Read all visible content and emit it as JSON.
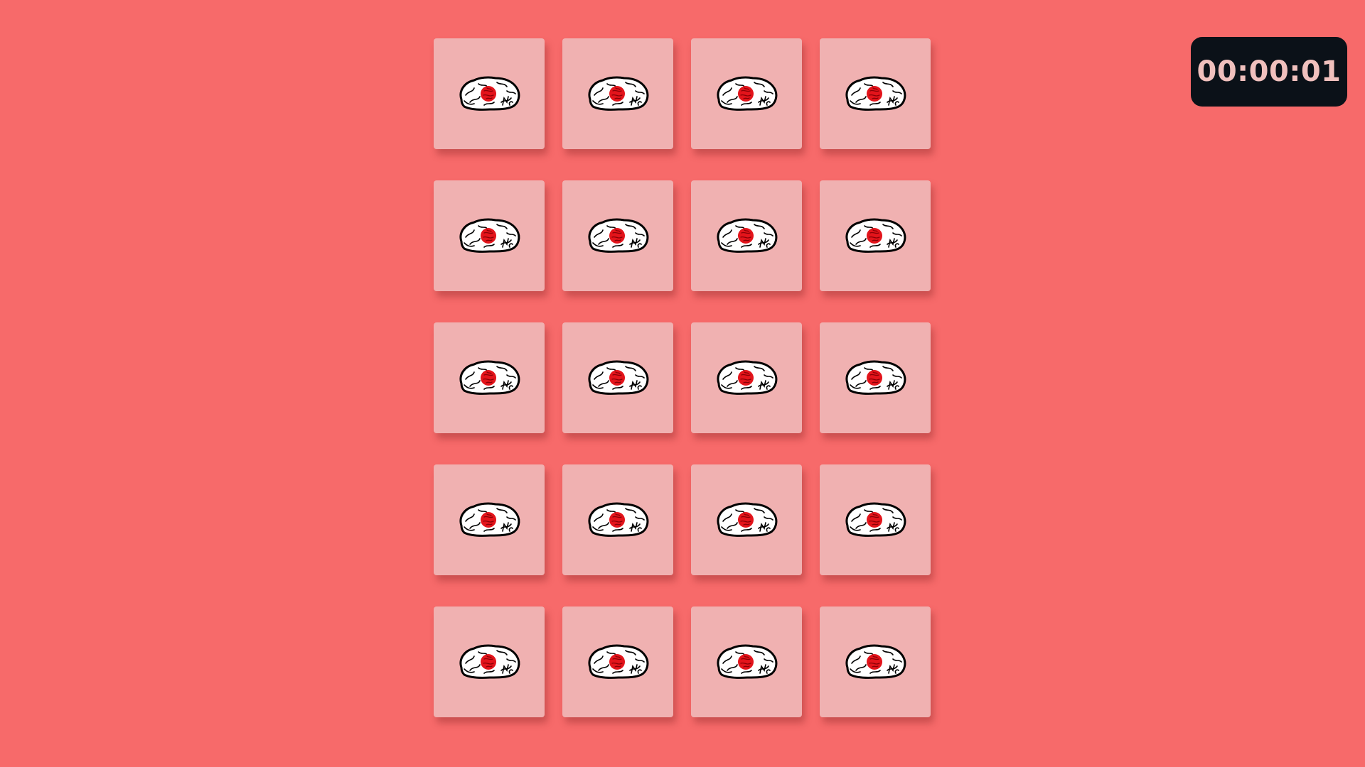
{
  "timer": {
    "value": "00:00:01"
  },
  "board": {
    "rows": 5,
    "columns": 4,
    "cards": [
      {
        "icon": "brain-icon",
        "face": "down"
      },
      {
        "icon": "brain-icon",
        "face": "down"
      },
      {
        "icon": "brain-icon",
        "face": "down"
      },
      {
        "icon": "brain-icon",
        "face": "down"
      },
      {
        "icon": "brain-icon",
        "face": "down"
      },
      {
        "icon": "brain-icon",
        "face": "down"
      },
      {
        "icon": "brain-icon",
        "face": "down"
      },
      {
        "icon": "brain-icon",
        "face": "down"
      },
      {
        "icon": "brain-icon",
        "face": "down"
      },
      {
        "icon": "brain-icon",
        "face": "down"
      },
      {
        "icon": "brain-icon",
        "face": "down"
      },
      {
        "icon": "brain-icon",
        "face": "down"
      },
      {
        "icon": "brain-icon",
        "face": "down"
      },
      {
        "icon": "brain-icon",
        "face": "down"
      },
      {
        "icon": "brain-icon",
        "face": "down"
      },
      {
        "icon": "brain-icon",
        "face": "down"
      },
      {
        "icon": "brain-icon",
        "face": "down"
      },
      {
        "icon": "brain-icon",
        "face": "down"
      },
      {
        "icon": "brain-icon",
        "face": "down"
      },
      {
        "icon": "brain-icon",
        "face": "down"
      }
    ]
  },
  "colors": {
    "background": "#f76a6a",
    "card": "#f0b1b1",
    "timer_bg": "#0b1118",
    "timer_text": "#f0c0bd",
    "brain_spot": "#e3141b"
  }
}
